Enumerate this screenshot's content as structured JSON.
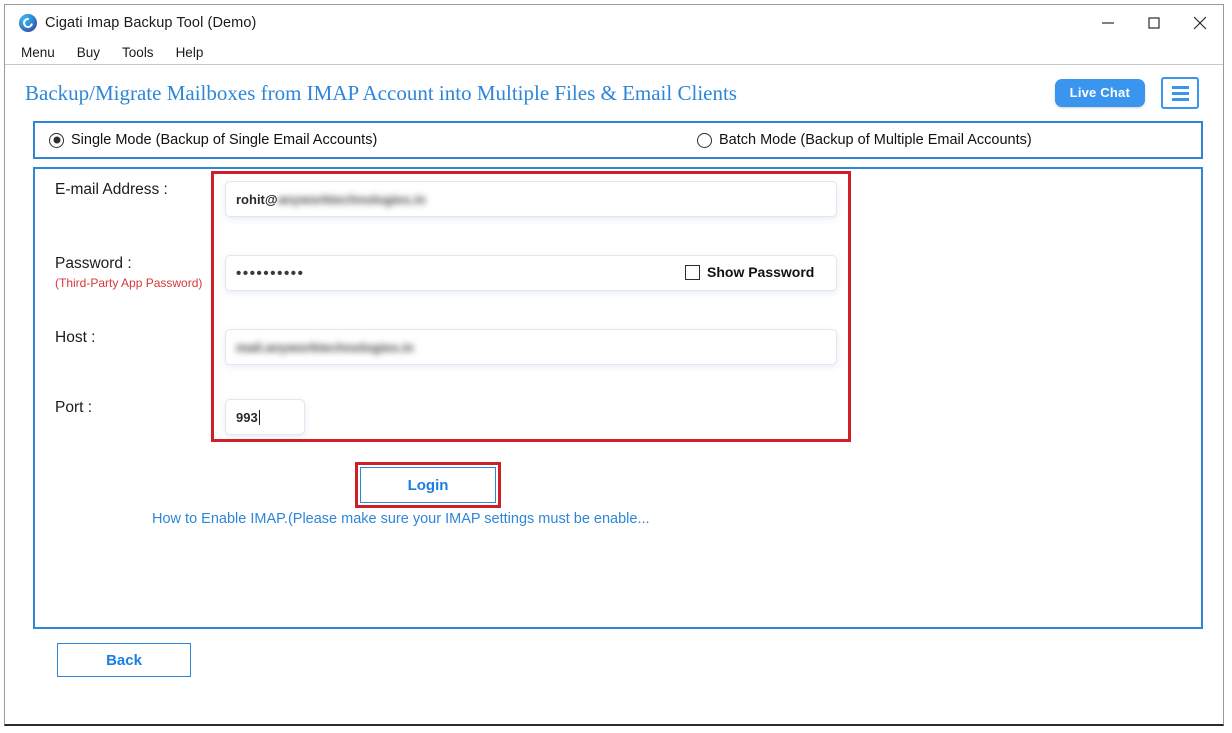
{
  "window": {
    "title": "Cigati Imap Backup Tool (Demo)",
    "app_icon": "cigati-logo-icon",
    "controls": {
      "minimize": "minimize-icon",
      "maximize": "maximize-icon",
      "close": "close-icon"
    }
  },
  "menubar": {
    "items": [
      {
        "label": "Menu"
      },
      {
        "label": "Buy"
      },
      {
        "label": "Tools"
      },
      {
        "label": "Help"
      }
    ]
  },
  "header": {
    "title": "Backup/Migrate Mailboxes from IMAP Account into Multiple Files & Email Clients",
    "live_chat_label": "Live Chat",
    "menu_icon": "hamburger-menu-icon",
    "accent_color": "#3a95ef",
    "title_color": "#2e86d8"
  },
  "mode_bar": {
    "options": [
      {
        "label": "Single Mode (Backup of Single Email Accounts)",
        "selected": true
      },
      {
        "label": "Batch Mode (Backup of Multiple Email Accounts)",
        "selected": false
      }
    ]
  },
  "form": {
    "email": {
      "label": "E-mail Address :",
      "value_visible": "rohit@",
      "value_blurred": "anyworktechnologies.in"
    },
    "password": {
      "label": "Password :",
      "sublabel": "(Third-Party App Password)",
      "value": "••••••••••",
      "show_password_label": "Show Password",
      "show_password_checked": false
    },
    "host": {
      "label": "Host :",
      "value_blurred": "mail.anyworktechnologies.in"
    },
    "port": {
      "label": "Port :",
      "value": "993"
    },
    "login_label": "Login",
    "imap_help_link": "How to Enable IMAP.(Please make sure your IMAP settings must be enable...",
    "highlight_color": "#cf2028"
  },
  "footer": {
    "back_label": "Back"
  }
}
